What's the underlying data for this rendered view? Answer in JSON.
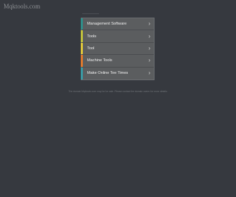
{
  "site": {
    "title": "Mqktools.com"
  },
  "menu": {
    "items": [
      {
        "label": "Management Software",
        "accent": "#2f8f8a"
      },
      {
        "label": "Tools",
        "accent": "#c2c23c"
      },
      {
        "label": "Tool",
        "accent": "#e0c73a"
      },
      {
        "label": "Machine Tools",
        "accent": "#e07a2e"
      },
      {
        "label": "Make Online Tee Times",
        "accent": "#3a9aa4"
      }
    ],
    "chevron_icon": "chevron-right-icon"
  },
  "footer": {
    "note": "The domain Mqktools.com may be for sale. Please contact the domain owner for more details."
  }
}
